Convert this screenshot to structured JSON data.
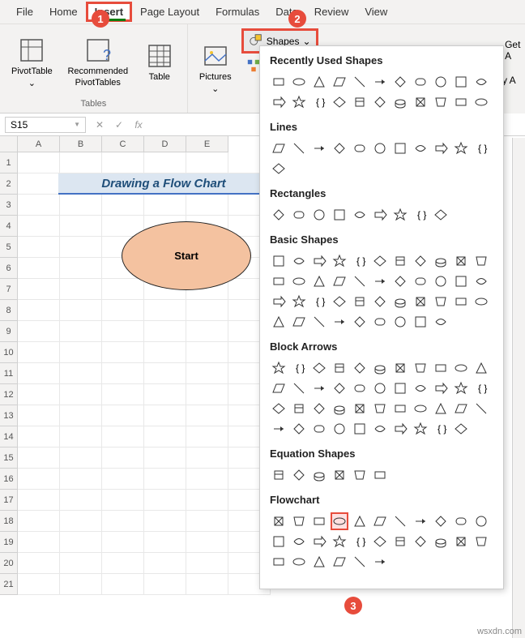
{
  "tabs": [
    "File",
    "Home",
    "Insert",
    "Page Layout",
    "Formulas",
    "Data",
    "Review",
    "View"
  ],
  "ribbon": {
    "pivotTable": "PivotTable",
    "recommended": "Recommended\nPivotTables",
    "table": "Table",
    "pictures": "Pictures",
    "shapes": "Shapes",
    "smartart": "SmartArt",
    "getAddins": "Get A",
    "myAddins": "My A",
    "tablesGroup": "Tables"
  },
  "nameBox": "S15",
  "columns": [
    "A",
    "B",
    "C",
    "D",
    "E"
  ],
  "rowCount": 21,
  "titleCell": "Drawing a Flow Chart",
  "ovalText": "Start",
  "badges": {
    "1": "1",
    "2": "2",
    "3": "3"
  },
  "dropdown": {
    "sections": [
      {
        "title": "Recently Used Shapes",
        "count": 22,
        "rows": 2
      },
      {
        "title": "Lines",
        "count": 12,
        "rows": 1
      },
      {
        "title": "Rectangles",
        "count": 9,
        "rows": 1
      },
      {
        "title": "Basic Shapes",
        "count": 42,
        "rows": 4
      },
      {
        "title": "Block Arrows",
        "count": 43,
        "rows": 4
      },
      {
        "title": "Equation Shapes",
        "count": 6,
        "rows": 1
      },
      {
        "title": "Flowchart",
        "count": 28,
        "rows": 3,
        "selectedIndex": 3
      }
    ]
  },
  "watermark": "wsxdn.com"
}
